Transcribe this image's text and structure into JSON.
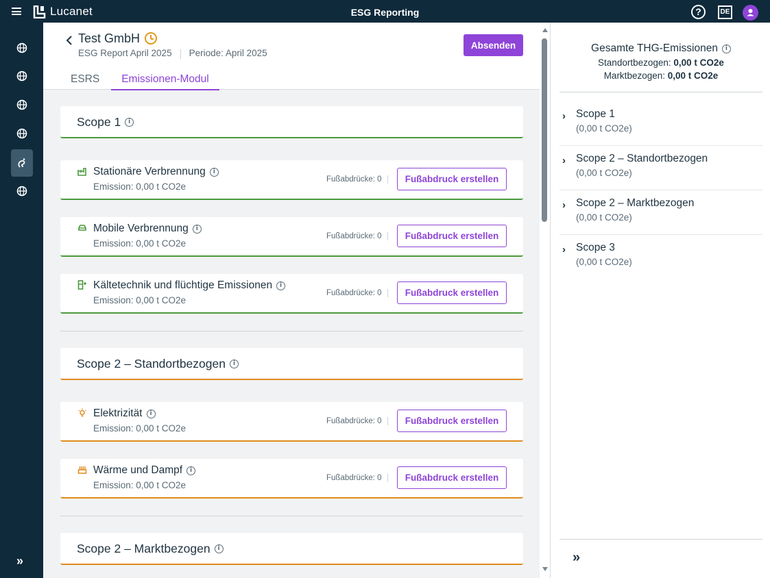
{
  "topbar": {
    "logo_text": "Lucanet",
    "app_title": "ESG Reporting",
    "help_label": "?",
    "language": "DE"
  },
  "header": {
    "company": "Test GmbH",
    "report": "ESG Report April 2025",
    "period": "Periode: April 2025",
    "send_label": "Absenden"
  },
  "tabs": [
    {
      "label": "ESRS",
      "active": false
    },
    {
      "label": "Emissionen-Modul",
      "active": true
    }
  ],
  "scopes": [
    {
      "title": "Scope 1"
    },
    {
      "title": "Scope 2 – Standortbezogen"
    },
    {
      "title": "Scope 2 – Marktbezogen"
    }
  ],
  "categories": [
    {
      "name": "Stationäre Verbrennung",
      "emission": "Emission: 0,00 t CO2e",
      "footprints": "Fußabdrücke: 0",
      "button": "Fußabdruck erstellen",
      "icon": "factory-icon"
    },
    {
      "name": "Mobile Verbrennung",
      "emission": "Emission: 0,00 t CO2e",
      "footprints": "Fußabdrücke: 0",
      "button": "Fußabdruck erstellen",
      "icon": "car-icon"
    },
    {
      "name": "Kältetechnik und flüchtige Emissionen",
      "emission": "Emission: 0,00 t CO2e",
      "footprints": "Fußabdrücke: 0",
      "button": "Fußabdruck erstellen",
      "icon": "refrigerator-icon"
    },
    {
      "name": "Elektrizität",
      "emission": "Emission: 0,00 t CO2e",
      "footprints": "Fußabdrücke: 0",
      "button": "Fußabdruck erstellen",
      "icon": "lightbulb-icon"
    },
    {
      "name": "Wärme und Dampf",
      "emission": "Emission: 0,00 t CO2e",
      "footprints": "Fußabdrücke: 0",
      "button": "Fußabdruck erstellen",
      "icon": "heater-icon"
    }
  ],
  "summary": {
    "title": "Gesamte THG-Emissionen",
    "location_label": "Standortbezogen:",
    "location_value": "0,00 t CO2e",
    "market_label": "Marktbezogen:",
    "market_value": "0,00 t CO2e"
  },
  "summary_scopes": [
    {
      "name": "Scope 1",
      "value": "(0,00 t CO2e)"
    },
    {
      "name": "Scope 2 – Standortbezogen",
      "value": "(0,00 t CO2e)"
    },
    {
      "name": "Scope 2 – Marktbezogen",
      "value": "(0,00 t CO2e)"
    },
    {
      "name": "Scope 3",
      "value": "(0,00 t CO2e)"
    }
  ],
  "rail_expand": "»",
  "panel_expand": "»",
  "colors": {
    "accent": "#8e44d8",
    "navy": "#0f2a3b",
    "scope1": "#4a9a3c",
    "scope2": "#e08a1c"
  }
}
